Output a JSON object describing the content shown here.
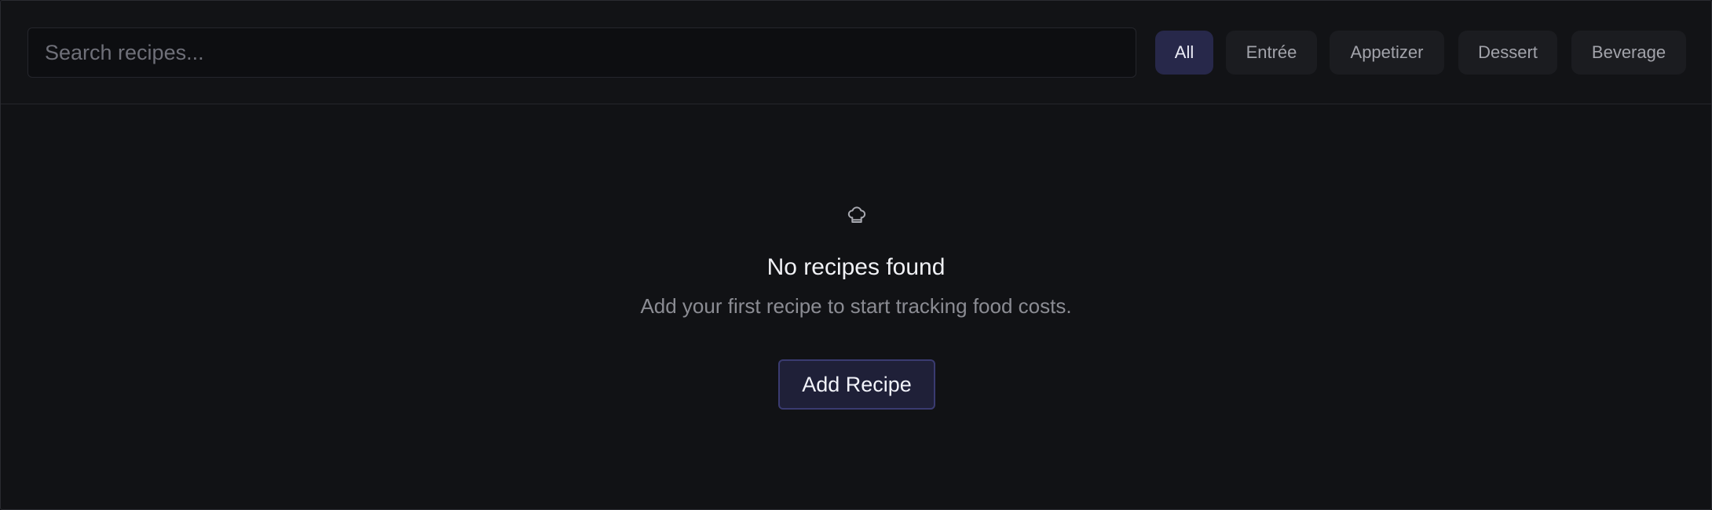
{
  "search": {
    "placeholder": "Search recipes...",
    "value": ""
  },
  "filters": [
    {
      "label": "All",
      "active": true
    },
    {
      "label": "Entrée",
      "active": false
    },
    {
      "label": "Appetizer",
      "active": false
    },
    {
      "label": "Dessert",
      "active": false
    },
    {
      "label": "Beverage",
      "active": false
    }
  ],
  "empty_state": {
    "icon": "chef-hat-icon",
    "title": "No recipes found",
    "subtitle": "Add your first recipe to start tracking food costs.",
    "button_label": "Add Recipe"
  },
  "colors": {
    "background": "#111215",
    "active_chip": "#27284a",
    "accent_border": "#3a3b70"
  }
}
